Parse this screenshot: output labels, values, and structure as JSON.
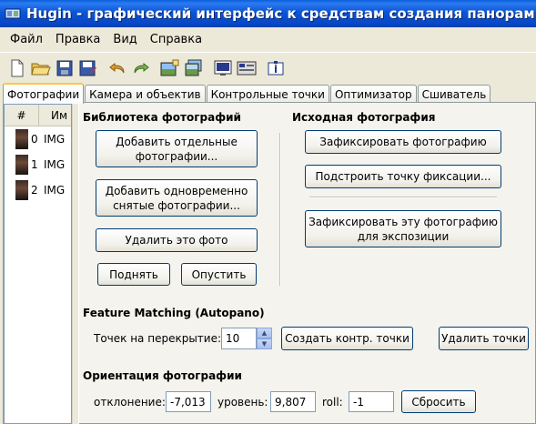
{
  "window": {
    "title": "Hugin - графический интерфейс к средствам создания панорам"
  },
  "menu": {
    "items": [
      "Файл",
      "Правка",
      "Вид",
      "Справка"
    ]
  },
  "toolbar": {
    "icons": [
      "new-file-icon",
      "open-folder-icon",
      "save-icon",
      "save-as-icon",
      "undo-icon",
      "redo-icon",
      "add-image-icon",
      "add-time-series-icon",
      "preview-icon",
      "gl-preview-icon",
      "info-icon"
    ]
  },
  "tabs": [
    "Фотографии",
    "Камера и объектив",
    "Контрольные точки",
    "Оптимизатор",
    "Сшиватель"
  ],
  "image_list": {
    "columns": [
      "#",
      "Им"
    ],
    "rows": [
      {
        "num": "0",
        "name": "IMG"
      },
      {
        "num": "1",
        "name": "IMG"
      },
      {
        "num": "2",
        "name": "IMG"
      }
    ]
  },
  "library": {
    "heading": "Библиотека фотографий",
    "add_individual": "Добавить отдельные фотографии...",
    "add_series": "Добавить одновременно снятые фотографии...",
    "remove": "Удалить это фото",
    "move_up": "Поднять",
    "move_down": "Опустить"
  },
  "anchor": {
    "heading": "Исходная фотография",
    "set_anchor": "Зафиксировать фотографию",
    "fit_anchor": "Подстроить точку фиксации...",
    "set_exposure": "Зафиксировать эту фотографию для экспозиции"
  },
  "feature_matching": {
    "heading": "Feature Matching (Autopano)",
    "points_label": "Точек на перекрытие:",
    "points_value": "10",
    "create_points": "Создать контр. точки",
    "delete_points": "Удалить точки"
  },
  "orientation": {
    "heading": "Ориентация фотографии",
    "yaw_label": "отклонение:",
    "yaw_value": "-7,013",
    "pitch_label": "уровень:",
    "pitch_value": "9,807",
    "roll_label": "roll:",
    "roll_value": "-1",
    "reset": "Сбросить"
  }
}
